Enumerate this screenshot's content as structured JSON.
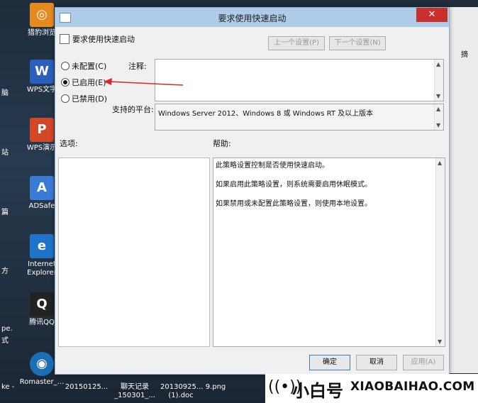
{
  "desktop": {
    "icons": [
      {
        "label": "猎豹浏览",
        "glyph": "◎",
        "color": "#e58a1f"
      },
      {
        "label": "WPS文字",
        "glyph": "W",
        "color": "#2b5fbd"
      },
      {
        "label": "WPS演示",
        "glyph": "P",
        "color": "#d24726"
      },
      {
        "label": "ADSafe",
        "glyph": "A",
        "color": "#3a7bd5"
      },
      {
        "label": "Internet Explorer",
        "glyph": "e",
        "color": "#1f74c9"
      },
      {
        "label": "腾讯QQ",
        "glyph": "Q",
        "color": "#222222"
      },
      {
        "label": "Romaster_...",
        "glyph": "◉",
        "color": "#1b6fb5"
      }
    ],
    "partial_left": [
      "脑",
      "站",
      "篇",
      "方",
      "pe.",
      "式",
      "ke -"
    ],
    "bottom_files": [
      "20150125...",
      "聊天记录_150301_...",
      "20130925... (1).doc",
      "9.png"
    ],
    "right_partial": [
      "摘"
    ]
  },
  "dialog": {
    "title": "要求使用快速启动",
    "close_glyph": "✕",
    "policy_name": "要求使用快速启动",
    "prev_button": "上一个设置(P)",
    "next_button": "下一个设置(N)",
    "radio_not_configured": "未配置(C)",
    "radio_enabled": "已启用(E)",
    "radio_disabled": "已禁用(D)",
    "comment_label": "注释:",
    "platform_label": "支持的平台:",
    "platform_value": "Windows Server 2012、Windows 8 或 Windows RT 及以上版本",
    "options_label": "选项:",
    "help_label": "帮助:",
    "help_lines": [
      "此策略设置控制是否使用快速启动。",
      "如果启用此策略设置，则系统需要启用休眠模式。",
      "如果禁用或未配置此策略设置，则使用本地设置。"
    ],
    "ok_button": "确定",
    "cancel_button": "取消",
    "apply_button": "应用(A)",
    "selected_option": "enabled"
  },
  "brand": {
    "name": "小白号",
    "url": "XIAOBAIHAO.COM"
  },
  "colors": {
    "titlebar": "#aecbe8",
    "close": "#c9302c",
    "annotation_arrow": "#d62b2b"
  }
}
